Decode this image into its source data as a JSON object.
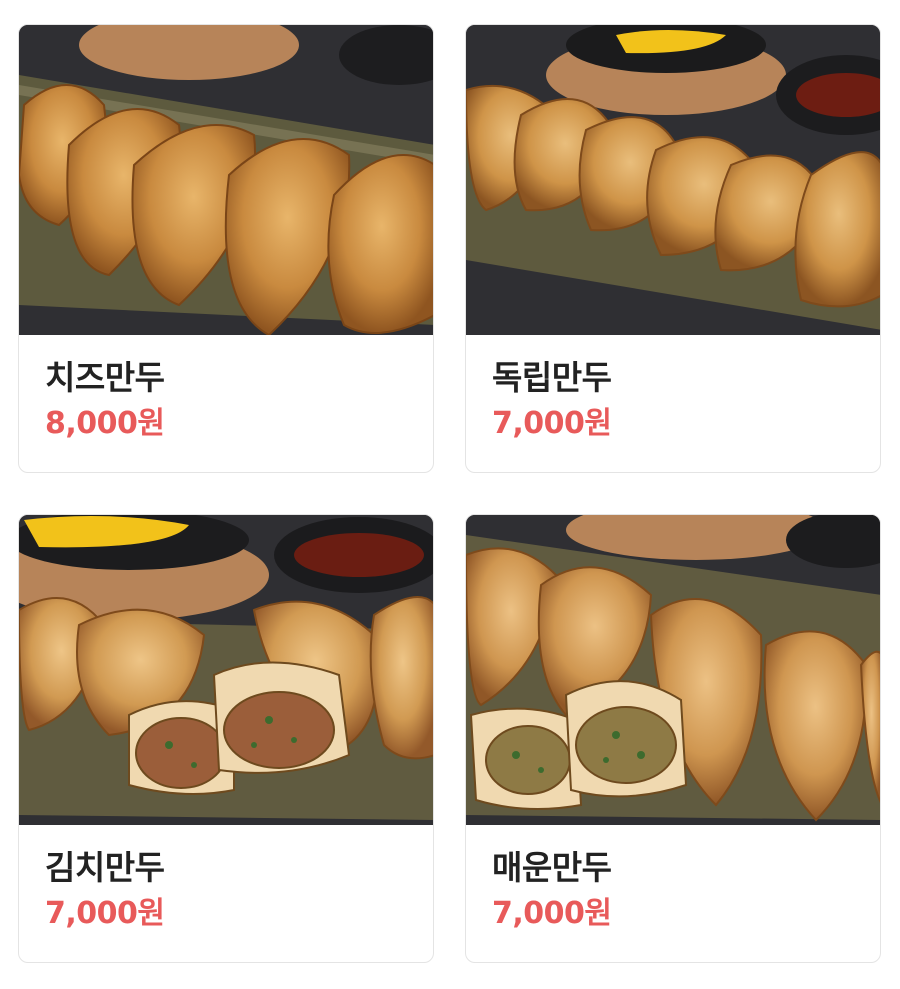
{
  "menu_items": [
    {
      "name": "치즈만두",
      "price": "8,000원",
      "image": "fried-dumplings-photo"
    },
    {
      "name": "독립만두",
      "price": "7,000원",
      "image": "fried-dumplings-photo"
    },
    {
      "name": "김치만두",
      "price": "7,000원",
      "image": "kimchi-dumplings-cut-photo"
    },
    {
      "name": "매운만두",
      "price": "7,000원",
      "image": "spicy-dumplings-cut-photo"
    }
  ],
  "colors": {
    "price": "#e85a5a",
    "name": "#222222",
    "card_border": "#e4e4e4"
  }
}
